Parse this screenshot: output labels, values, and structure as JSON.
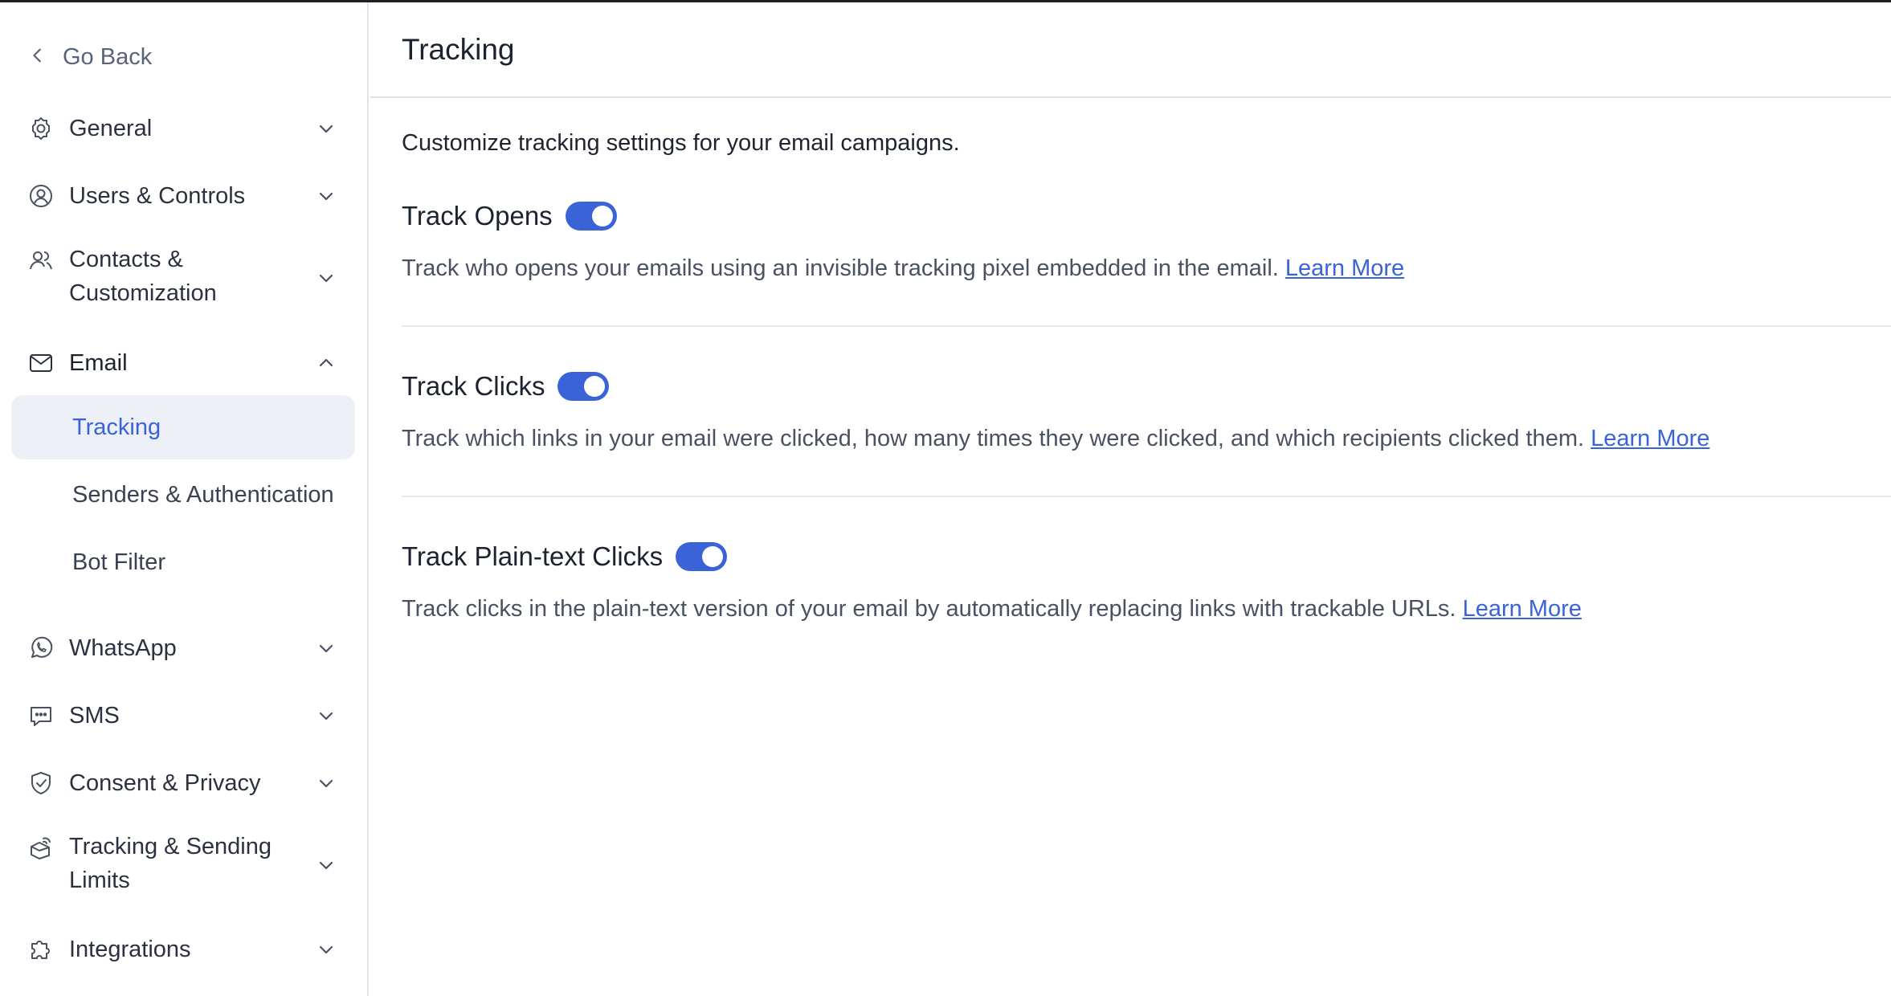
{
  "sidebar": {
    "go_back": "Go Back",
    "items": [
      {
        "label": "General",
        "icon": "gear-icon"
      },
      {
        "label": "Users & Controls",
        "icon": "user-circle-icon"
      },
      {
        "label_line1": "Contacts &",
        "label_line2": "Customization",
        "icon": "users-icon"
      },
      {
        "label": "Email",
        "icon": "mail-icon",
        "expanded": true
      },
      {
        "label": "WhatsApp",
        "icon": "whatsapp-icon"
      },
      {
        "label": "SMS",
        "icon": "chat-bubble-icon"
      },
      {
        "label": "Consent & Privacy",
        "icon": "shield-check-icon"
      },
      {
        "label_line1": "Tracking & Sending",
        "label_line2": "Limits",
        "icon": "tracking-limits-icon"
      },
      {
        "label": "Integrations",
        "icon": "puzzle-icon"
      }
    ],
    "email_sub": [
      {
        "label": "Tracking",
        "active": true
      },
      {
        "label": "Senders & Authentication"
      },
      {
        "label": "Bot Filter"
      }
    ]
  },
  "main": {
    "title": "Tracking",
    "intro": "Customize tracking settings for your email campaigns.",
    "settings": [
      {
        "title": "Track Opens",
        "enabled": true,
        "description": "Track who opens your emails using an invisible tracking pixel embedded in the email.",
        "link": "Learn More"
      },
      {
        "title": "Track Clicks",
        "enabled": true,
        "description": "Track which links in your email were clicked, how many times they were clicked, and which recipients clicked them.",
        "link": "Learn More"
      },
      {
        "title": "Track Plain-text Clicks",
        "enabled": true,
        "description": "Track clicks in the plain-text version of your email by automatically replacing links with trackable URLs.",
        "link": "Learn More"
      }
    ]
  },
  "colors": {
    "accent": "#3a63d8",
    "active_bg": "#eef0f8",
    "text": "#1f2430",
    "muted": "#4a5162"
  }
}
